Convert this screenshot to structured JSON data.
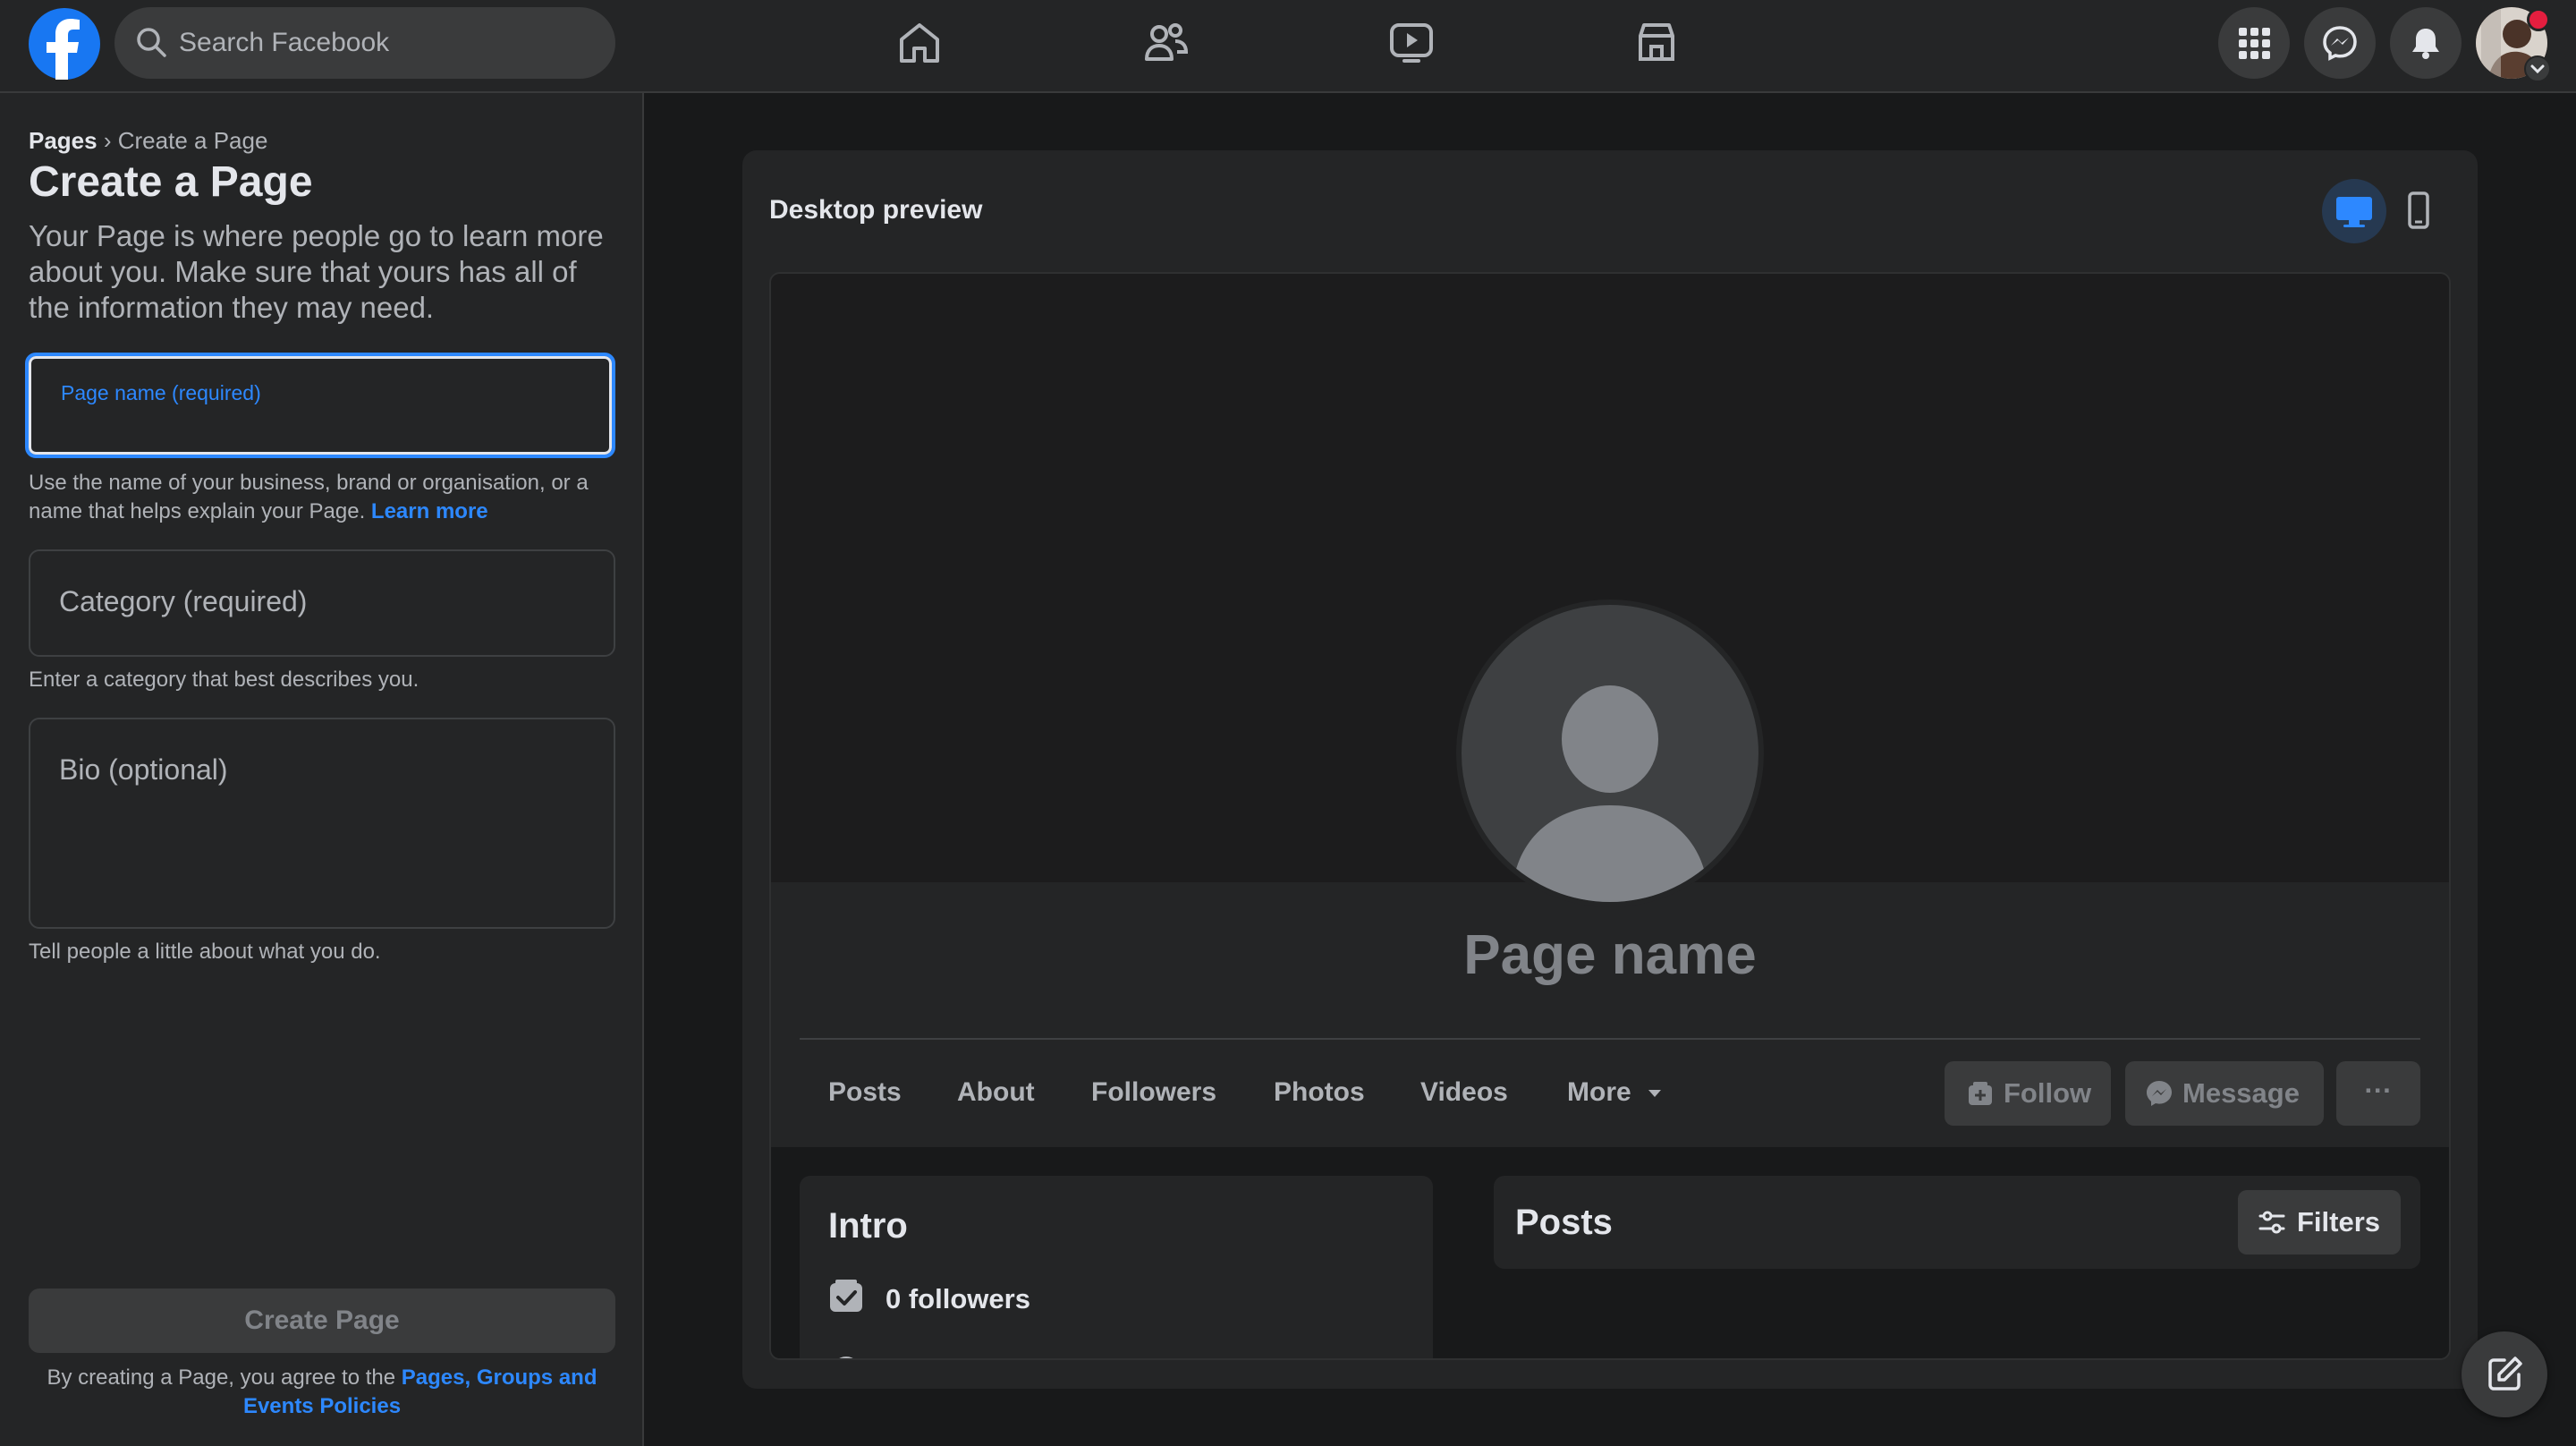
{
  "topbar": {
    "search_placeholder": "Search Facebook"
  },
  "breadcrumb": {
    "root": "Pages",
    "separator": "›",
    "current": "Create a Page"
  },
  "form": {
    "title": "Create a Page",
    "description": "Your Page is where people go to learn more about you. Make sure that yours has all of the information they may need.",
    "name_label": "Page name (required)",
    "name_value": "",
    "name_help": "Use the name of your business, brand or organisation, or a name that helps explain your Page.",
    "name_help_link": "Learn more",
    "category_placeholder": "Category (required)",
    "category_help": "Enter a category that best describes you.",
    "bio_placeholder": "Bio (optional)",
    "bio_help": "Tell people a little about what you do.",
    "create_button": "Create Page",
    "terms_prefix": "By creating a Page, you agree to the",
    "terms_link": "Pages, Groups and Events Policies"
  },
  "preview": {
    "title": "Desktop preview",
    "page_name": "Page name",
    "tabs": [
      "Posts",
      "About",
      "Followers",
      "Photos",
      "Videos",
      "More"
    ],
    "follow_label": "Follow",
    "message_label": "Message",
    "more_actions": "···",
    "intro_title": "Intro",
    "followers_text": "0 followers",
    "posts_title": "Posts",
    "filters_label": "Filters"
  },
  "colors": {
    "accent": "#2d88ff",
    "brand": "#1877f2",
    "notification": "#e41e3f"
  }
}
